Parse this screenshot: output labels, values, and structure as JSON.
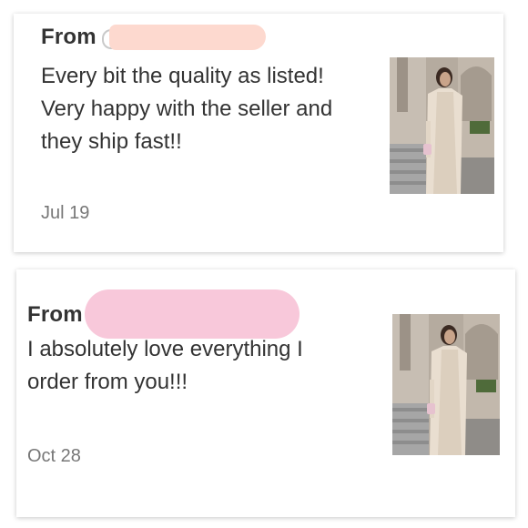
{
  "reviews": [
    {
      "from_label": "From",
      "message": "Every bit the quality as listed! Very happy with the seller and they ship fast!!",
      "date": "Jul 19",
      "redaction_color": "#fdd9cf"
    },
    {
      "from_label": "From",
      "message": "I absolutely love everything I order from you!!!",
      "date": "Oct 28",
      "redaction_color": "#f8c8da"
    }
  ],
  "colors": {
    "text": "#333333",
    "date": "#777777",
    "card_background": "#ffffff"
  }
}
